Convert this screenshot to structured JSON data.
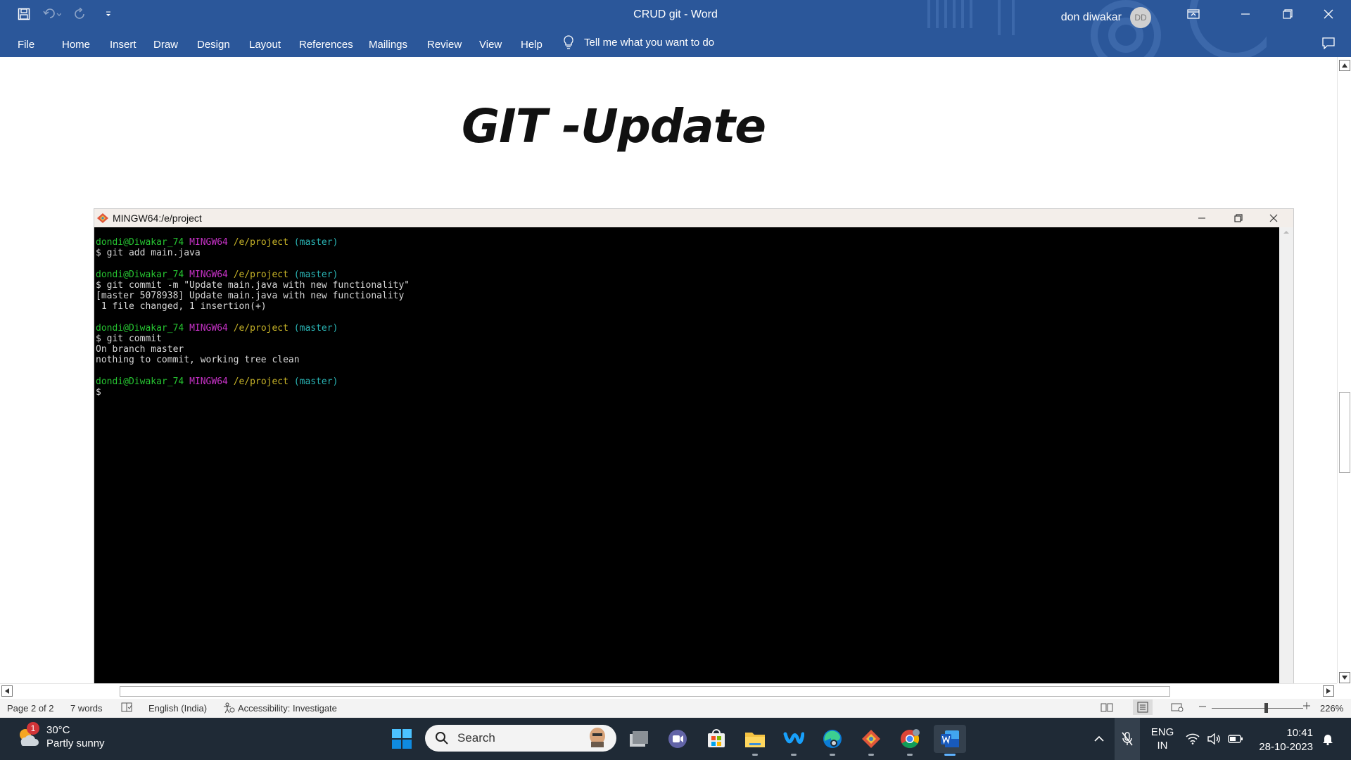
{
  "window": {
    "doc_title": "CRUD git  -  Word",
    "user_name": "don diwakar",
    "user_initials": "DD"
  },
  "ribbon": {
    "tabs": [
      "File",
      "Home",
      "Insert",
      "Draw",
      "Design",
      "Layout",
      "References",
      "Mailings",
      "Review",
      "View",
      "Help"
    ],
    "tell_me": "Tell me what you want to do"
  },
  "document": {
    "heading": "GIT -Update"
  },
  "terminal": {
    "title": "MINGW64:/e/project",
    "prompt_user": "dondi@Diwakar_74",
    "prompt_host": "MINGW64",
    "prompt_path": "/e/project",
    "prompt_branch": "(master)",
    "cmd1": "$ git add main.java",
    "cmd2": "$ git commit -m \"Update main.java with new functionality\"",
    "out2a": "[master 5078938] Update main.java with new functionality",
    "out2b": " 1 file changed, 1 insertion(+)",
    "cmd3": "$ git commit",
    "out3a": "On branch master",
    "out3b": "nothing to commit, working tree clean",
    "cmd4": "$"
  },
  "status": {
    "page": "Page 2 of 2",
    "words": "7 words",
    "language": "English (India)",
    "accessibility": "Accessibility: Investigate",
    "zoom": "226%"
  },
  "taskbar": {
    "temperature": "30°C",
    "condition": "Partly sunny",
    "weather_badge": "1",
    "search_label": "Search",
    "lang_line1": "ENG",
    "lang_line2": "IN",
    "time": "10:41",
    "date": "28-10-2023",
    "colors": {
      "taskbar_bg": "#1f2a36",
      "word_blue": "#2b579a"
    }
  }
}
